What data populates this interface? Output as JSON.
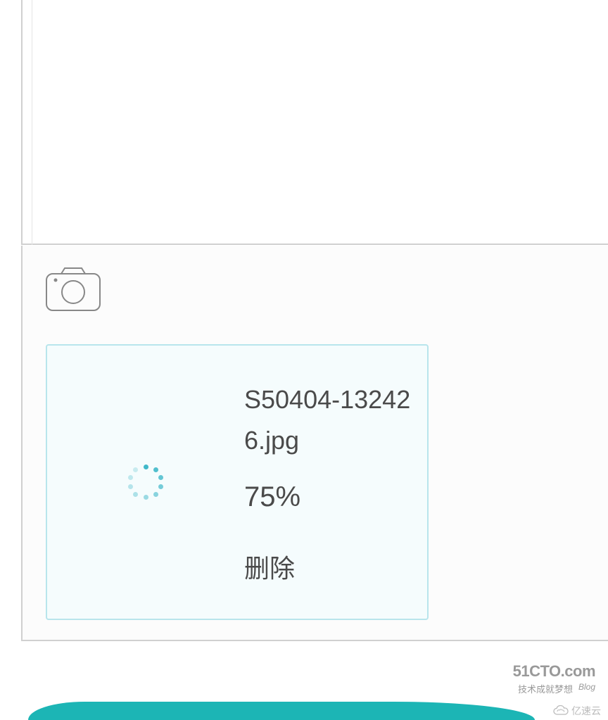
{
  "upload": {
    "filename": "S50404-132426.jpg",
    "progress": "75%",
    "delete_label": "删除"
  },
  "watermark": {
    "site": "51CTO.com",
    "subtitle": "技术成就梦想",
    "tag": "Blog",
    "bottom": "亿速云"
  }
}
